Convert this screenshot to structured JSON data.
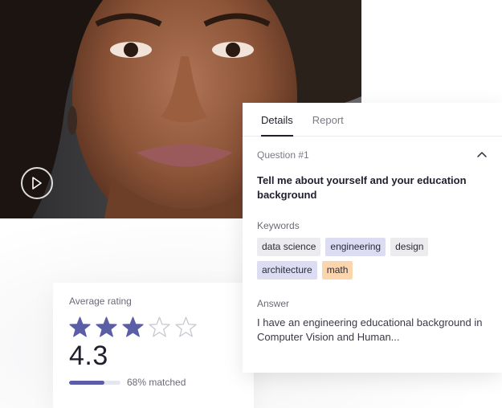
{
  "details_panel": {
    "tabs": [
      {
        "label": "Details",
        "active": true
      },
      {
        "label": "Report",
        "active": false
      }
    ],
    "question_label": "Question #1",
    "question_title": "Tell me about yourself and your education background",
    "keywords_label": "Keywords",
    "keywords": [
      {
        "label": "data science",
        "color": "#ececef"
      },
      {
        "label": "engineering",
        "color": "#dcdcf3"
      },
      {
        "label": "design",
        "color": "#ececef"
      },
      {
        "label": "architecture",
        "color": "#dcdcf3"
      },
      {
        "label": "math",
        "color": "#fbd5ab"
      }
    ],
    "answer_label": "Answer",
    "answer_text": "I have an engineering educational background in Computer Vision and Human..."
  },
  "rating": {
    "label": "Average rating",
    "stars_filled": 3,
    "stars_total": 5,
    "value": "4.3",
    "match_fraction": 0.68,
    "match_text": "68% matched",
    "accent_color": "#5b5ea6"
  },
  "video": {
    "play_icon": "play-icon"
  }
}
